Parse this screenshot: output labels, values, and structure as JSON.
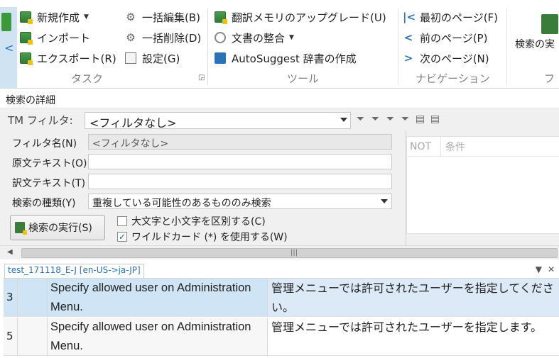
{
  "ribbon": {
    "groups": [
      {
        "label": "タスク"
      },
      {
        "label": "ツール"
      },
      {
        "label": "ナビゲーション"
      }
    ],
    "tasks": {
      "new": "新規作成",
      "import": "インポート",
      "export": "エクスポート(R)",
      "bulk_edit": "一括編集(B)",
      "bulk_delete": "一括削除(D)",
      "settings": "設定(G)"
    },
    "tools": {
      "upgrade": "翻訳メモリのアップグレード(U)",
      "align": "文書の整合",
      "autosuggest": "AutoSuggest 辞書の作成"
    },
    "navigation": {
      "first": "最初のページ(F)",
      "prev": "前のページ(P)",
      "next": "次のページ(N)"
    },
    "exec_search_big": "検索の実",
    "partial_group": "フ"
  },
  "search": {
    "panel_title": "検索の詳細",
    "tm_filter_label": "TM フィルタ:",
    "tm_filter_value": "<フィルタなし>",
    "filter_name_label": "フィルタ名(N)",
    "filter_name_value": "<フィルタなし>",
    "source_label": "原文テキスト(O)",
    "source_value": "",
    "target_label": "訳文テキスト(T)",
    "target_value": "",
    "search_type_label": "検索の種類(Y)",
    "search_type_value": "重複している可能性のあるもののみ検索",
    "exec_button": "検索の実行(S)",
    "case_sensitive_label": "大文字と小文字を区別する(C)",
    "case_sensitive_checked": false,
    "wildcard_label": "ワイルドカード (*) を使用する(W)",
    "wildcard_checked": true,
    "condition_headers": [
      "NOT",
      "条件"
    ]
  },
  "document": {
    "tab_label": "test_171118_E-J [en-US->ja-JP]",
    "rows": [
      {
        "number": "3",
        "source": "Specify allowed user on Administration Menu.",
        "target": "管理メニューでは許可されたユーザーを指定してください。"
      },
      {
        "number": "5",
        "source": "Specify allowed user on Administration Menu.",
        "target": "管理メニューでは許可されたユーザーを指定します。"
      }
    ]
  },
  "colors": {
    "accent": "#2b72b6",
    "selected_row": "#cfe4f5",
    "icon_green": "#3a7c3a"
  }
}
